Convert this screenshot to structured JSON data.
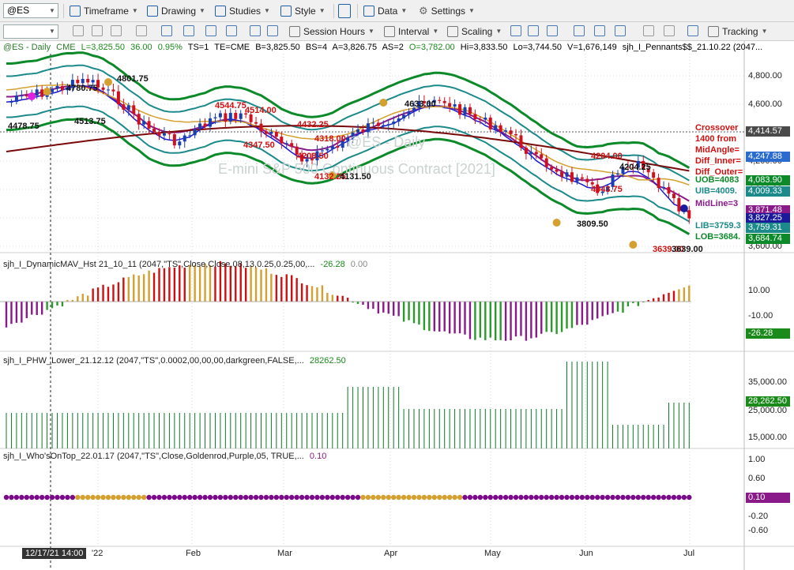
{
  "toolbar1": {
    "symbol": "@ES",
    "timeframe_label": "Timeframe",
    "drawing_label": "Drawing",
    "studies_label": "Studies",
    "style_label": "Style",
    "data_label": "Data",
    "settings_label": "Settings"
  },
  "toolbar2": {
    "session_hours_label": "Session Hours",
    "interval_label": "Interval",
    "scaling_label": "Scaling",
    "tracking_label": "Tracking"
  },
  "status_bar": {
    "symbol": "@ES - Daily",
    "exchange": "CME",
    "last": "L=3,825.50",
    "change": "36.00",
    "change_pct": "0.95%",
    "ts": "TS=1",
    "te": "TE=CME",
    "bid": "B=3,825.50",
    "bs": "BS=4",
    "ask": "A=3,826.75",
    "as": "AS=2",
    "open": "O=3,782.00",
    "high": "Hi=3,833.50",
    "low": "Lo=3,744.50",
    "volume": "V=1,676,149",
    "study": "sjh_I_Pennants$$_21.10.22 (2047..."
  },
  "watermark": {
    "line1": "@ES - Daily",
    "line2": "E-mini S&P 500 Continuous Contract [2021]"
  },
  "price_axis": [
    "4,800.00",
    "4,600.00",
    "4,400.00",
    "4,200.00",
    "4,000.00",
    "3,800.00",
    "3,600.00"
  ],
  "price_pills": [
    {
      "text": "4,414.57",
      "color": "#4a4a4a"
    },
    {
      "text": "4,247.88",
      "color": "#2a6bd0"
    },
    {
      "text": "4,083.90",
      "color": "#0c8a2a"
    },
    {
      "text": "4,009.33",
      "color": "#1c8a8a"
    },
    {
      "text": "3,871.48",
      "color": "#8a1a8a"
    },
    {
      "text": "3,827.25",
      "color": "#1a1a9a"
    },
    {
      "text": "3,759.31",
      "color": "#1c8a8a"
    },
    {
      "text": "3,684.74",
      "color": "#0c8a2a"
    }
  ],
  "right_labels": [
    {
      "text": "Crossover",
      "color": "#d01010"
    },
    {
      "text": "1400 from",
      "color": "#d01010"
    },
    {
      "text": "MidAngle=",
      "color": "#d01010"
    },
    {
      "text": "Diff_Inner=",
      "color": "#d01010"
    },
    {
      "text": "Diff_Outer=",
      "color": "#d01010"
    },
    {
      "text": "UOB=4083",
      "color": "#0c8a2a"
    },
    {
      "text": "UIB=4009.",
      "color": "#1c8a8a"
    },
    {
      "text": "MidLine=3",
      "color": "#8a1a8a"
    },
    {
      "text": "LIB=3759.3",
      "color": "#1c8a8a"
    },
    {
      "text": "LOB=3684.",
      "color": "#0c8a2a"
    }
  ],
  "price_annotations": [
    {
      "text": "4801.75",
      "color": "#111"
    },
    {
      "text": "4780.75",
      "color": "#111"
    },
    {
      "text": "4478.75",
      "color": "#111"
    },
    {
      "text": "4513.75",
      "color": "#111"
    },
    {
      "text": "4544.75",
      "color": "#d01010"
    },
    {
      "text": "4514.00",
      "color": "#d01010"
    },
    {
      "text": "4432.25",
      "color": "#d01010"
    },
    {
      "text": "4347.50",
      "color": "#d01010"
    },
    {
      "text": "4318.00",
      "color": "#d01010"
    },
    {
      "text": "4208.50",
      "color": "#d01010"
    },
    {
      "text": "4132.25",
      "color": "#d01010"
    },
    {
      "text": "4131.50",
      "color": "#111"
    },
    {
      "text": "4633.00",
      "color": "#111"
    },
    {
      "text": "4204.00",
      "color": "#d01010"
    },
    {
      "text": "4204.25",
      "color": "#111"
    },
    {
      "text": "4043.75",
      "color": "#d01010"
    },
    {
      "text": "3809.50",
      "color": "#111"
    },
    {
      "text": "3639.00",
      "color": "#d01010"
    },
    {
      "text": "3639.00",
      "color": "#111"
    }
  ],
  "ind1": {
    "title": "sjh_I_DynamicMAV_Hst 21_10_11 (2047,\"TS\",Close,Close,08,13,0.25,0.25,00,...",
    "value1": "-26.28",
    "value2": "0.00",
    "axis": [
      "10.00",
      "-10.00"
    ],
    "pill": "-26.28"
  },
  "ind2": {
    "title": "sjh_I_PHW_Lower_21.12.12 (2047,\"TS\",0.0002,00,00,00,darkgreen,FALSE,...",
    "value": "28262.50",
    "axis": [
      "35,000.00",
      "25,000.00",
      "15,000.00"
    ],
    "pill": "28,262.50"
  },
  "ind3": {
    "title": "sjh_I_Who'sOnTop_22.01.17 (2047,\"TS\",Close,Goldenrod,Purple,05, TRUE,...",
    "value": "0.10",
    "axis": [
      "1.00",
      "0.60",
      "0.20",
      "-0.20",
      "-0.60"
    ],
    "pill": "0.10"
  },
  "date_axis": [
    "'22",
    "Feb",
    "Mar",
    "Apr",
    "May",
    "Jun",
    "Jul"
  ],
  "cursor_date": "12/17/21 14:00",
  "colors": {
    "up_candle": "#1a3fb0",
    "down_candle": "#d01020",
    "band_outer": "#0c8a2a",
    "band_inner": "#1c8a8a",
    "ma_long": "#7a0a0a",
    "hist_up": "#d01010",
    "hist_up2": "#d4a030",
    "hist_down": "#8a1a8a",
    "hist_down2": "#2a9a2a",
    "vol": "#0c7a2a",
    "dot_purple": "#7a0a8a",
    "dot_gold": "#d4a030"
  }
}
